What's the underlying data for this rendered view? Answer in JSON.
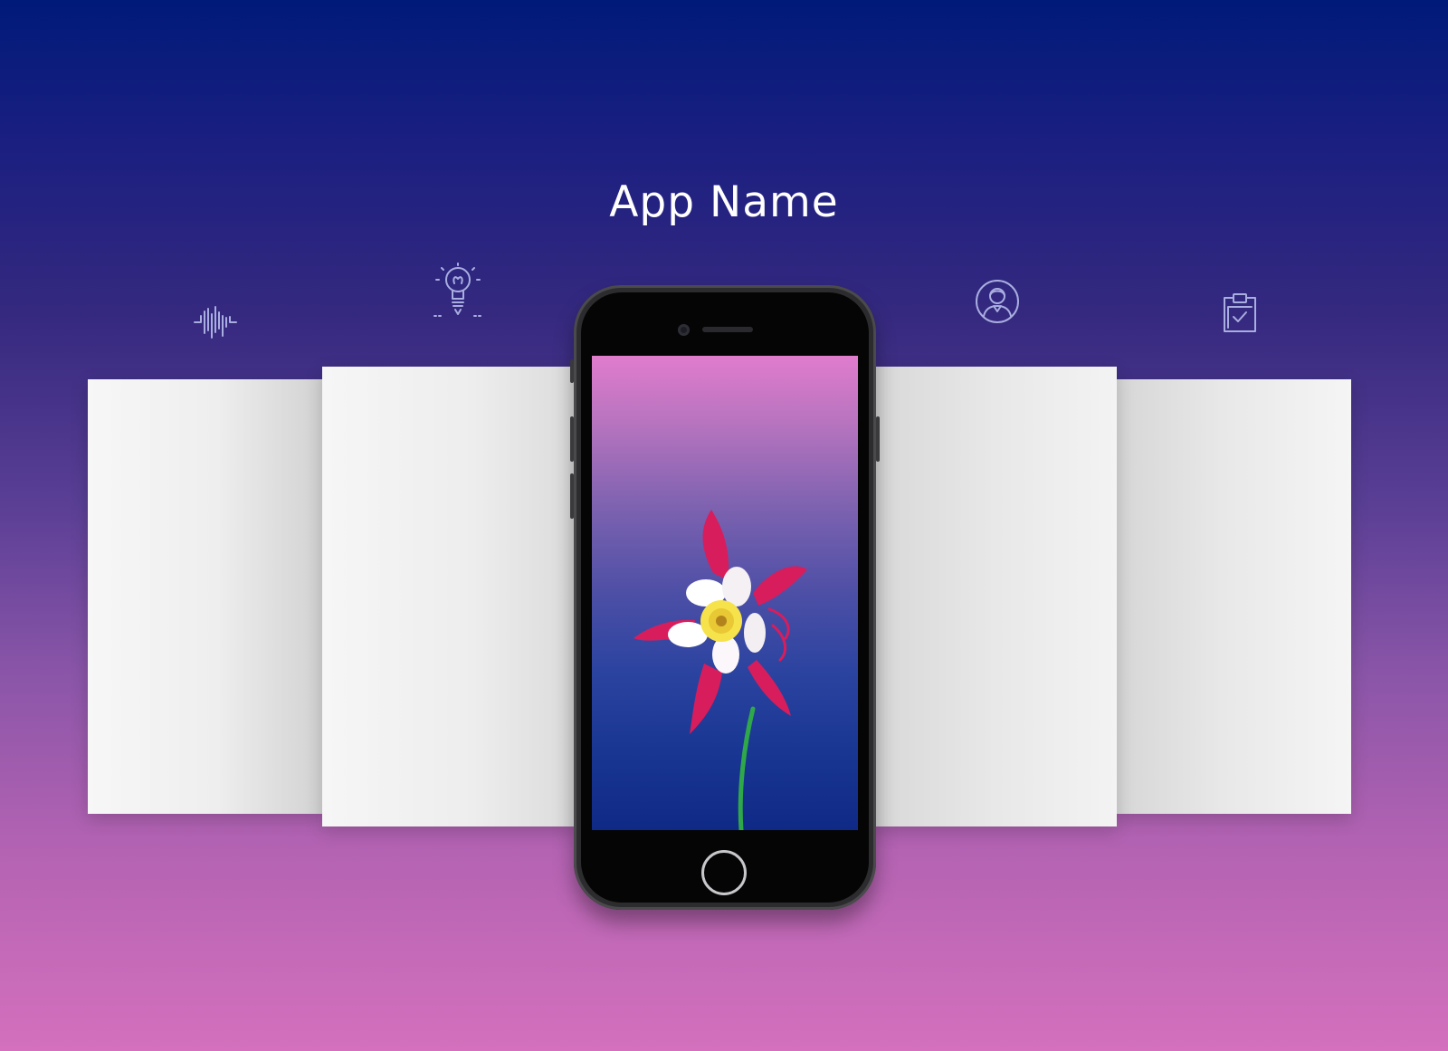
{
  "page": {
    "title": "App Name"
  },
  "colors": {
    "background_top": "#001a7a",
    "background_bottom": "#d470bd",
    "icon_stroke": "#a9aee0",
    "phone_body": "#2c2c2e",
    "flower_petals": "#d81d5c",
    "flower_center": "#ffffff",
    "stem": "#2fa84a"
  },
  "feature_icons": [
    {
      "name": "waveform-icon"
    },
    {
      "name": "lightbulb-icon"
    },
    {
      "name": "user-profile-icon"
    },
    {
      "name": "clipboard-check-icon"
    }
  ],
  "screenshot_cards": [
    {
      "name": "screenshot-card-1"
    },
    {
      "name": "screenshot-card-2"
    },
    {
      "name": "screenshot-card-3"
    },
    {
      "name": "screenshot-card-4"
    }
  ],
  "phone": {
    "model": "smartphone",
    "wallpaper": "red-columbine-flower"
  }
}
